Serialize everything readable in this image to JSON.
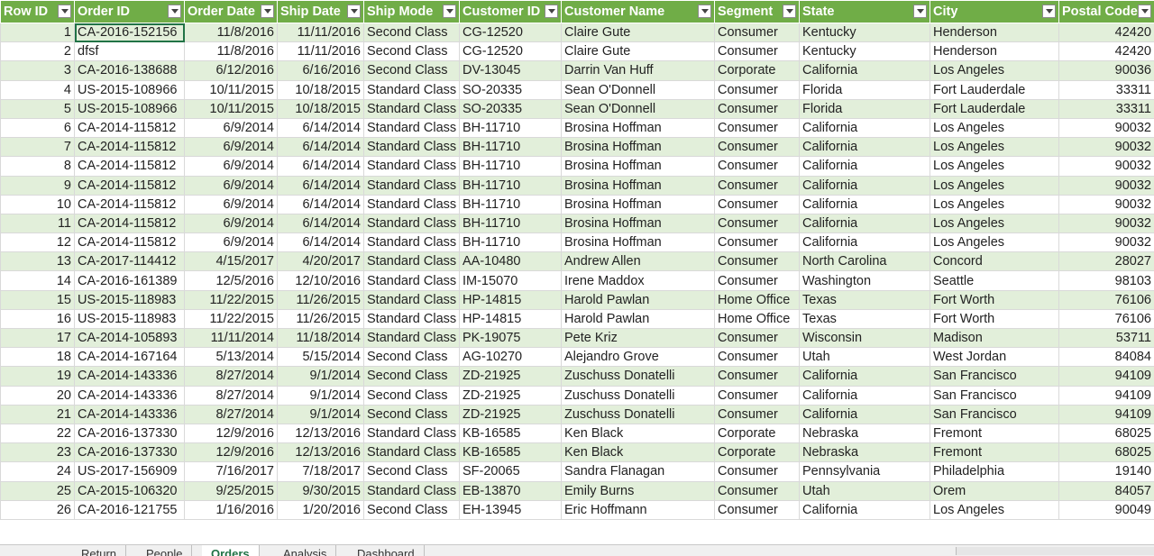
{
  "columns": [
    "Row ID",
    "Order ID",
    "Order Date",
    "Ship Date",
    "Ship Mode",
    "Customer ID",
    "Customer Name",
    "Segment",
    "State",
    "City",
    "Postal Code"
  ],
  "rows": [
    [
      "1",
      "CA-2016-152156",
      "11/8/2016",
      "11/11/2016",
      "Second Class",
      "CG-12520",
      "Claire Gute",
      "Consumer",
      "Kentucky",
      "Henderson",
      "42420"
    ],
    [
      "2",
      "dfsf",
      "11/8/2016",
      "11/11/2016",
      "Second Class",
      "CG-12520",
      "Claire Gute",
      "Consumer",
      "Kentucky",
      "Henderson",
      "42420"
    ],
    [
      "3",
      "CA-2016-138688",
      "6/12/2016",
      "6/16/2016",
      "Second Class",
      "DV-13045",
      "Darrin Van Huff",
      "Corporate",
      "California",
      "Los Angeles",
      "90036"
    ],
    [
      "4",
      "US-2015-108966",
      "10/11/2015",
      "10/18/2015",
      "Standard Class",
      "SO-20335",
      "Sean O'Donnell",
      "Consumer",
      "Florida",
      "Fort Lauderdale",
      "33311"
    ],
    [
      "5",
      "US-2015-108966",
      "10/11/2015",
      "10/18/2015",
      "Standard Class",
      "SO-20335",
      "Sean O'Donnell",
      "Consumer",
      "Florida",
      "Fort Lauderdale",
      "33311"
    ],
    [
      "6",
      "CA-2014-115812",
      "6/9/2014",
      "6/14/2014",
      "Standard Class",
      "BH-11710",
      "Brosina Hoffman",
      "Consumer",
      "California",
      "Los Angeles",
      "90032"
    ],
    [
      "7",
      "CA-2014-115812",
      "6/9/2014",
      "6/14/2014",
      "Standard Class",
      "BH-11710",
      "Brosina Hoffman",
      "Consumer",
      "California",
      "Los Angeles",
      "90032"
    ],
    [
      "8",
      "CA-2014-115812",
      "6/9/2014",
      "6/14/2014",
      "Standard Class",
      "BH-11710",
      "Brosina Hoffman",
      "Consumer",
      "California",
      "Los Angeles",
      "90032"
    ],
    [
      "9",
      "CA-2014-115812",
      "6/9/2014",
      "6/14/2014",
      "Standard Class",
      "BH-11710",
      "Brosina Hoffman",
      "Consumer",
      "California",
      "Los Angeles",
      "90032"
    ],
    [
      "10",
      "CA-2014-115812",
      "6/9/2014",
      "6/14/2014",
      "Standard Class",
      "BH-11710",
      "Brosina Hoffman",
      "Consumer",
      "California",
      "Los Angeles",
      "90032"
    ],
    [
      "11",
      "CA-2014-115812",
      "6/9/2014",
      "6/14/2014",
      "Standard Class",
      "BH-11710",
      "Brosina Hoffman",
      "Consumer",
      "California",
      "Los Angeles",
      "90032"
    ],
    [
      "12",
      "CA-2014-115812",
      "6/9/2014",
      "6/14/2014",
      "Standard Class",
      "BH-11710",
      "Brosina Hoffman",
      "Consumer",
      "California",
      "Los Angeles",
      "90032"
    ],
    [
      "13",
      "CA-2017-114412",
      "4/15/2017",
      "4/20/2017",
      "Standard Class",
      "AA-10480",
      "Andrew Allen",
      "Consumer",
      "North Carolina",
      "Concord",
      "28027"
    ],
    [
      "14",
      "CA-2016-161389",
      "12/5/2016",
      "12/10/2016",
      "Standard Class",
      "IM-15070",
      "Irene Maddox",
      "Consumer",
      "Washington",
      "Seattle",
      "98103"
    ],
    [
      "15",
      "US-2015-118983",
      "11/22/2015",
      "11/26/2015",
      "Standard Class",
      "HP-14815",
      "Harold Pawlan",
      "Home Office",
      "Texas",
      "Fort Worth",
      "76106"
    ],
    [
      "16",
      "US-2015-118983",
      "11/22/2015",
      "11/26/2015",
      "Standard Class",
      "HP-14815",
      "Harold Pawlan",
      "Home Office",
      "Texas",
      "Fort Worth",
      "76106"
    ],
    [
      "17",
      "CA-2014-105893",
      "11/11/2014",
      "11/18/2014",
      "Standard Class",
      "PK-19075",
      "Pete Kriz",
      "Consumer",
      "Wisconsin",
      "Madison",
      "53711"
    ],
    [
      "18",
      "CA-2014-167164",
      "5/13/2014",
      "5/15/2014",
      "Second Class",
      "AG-10270",
      "Alejandro Grove",
      "Consumer",
      "Utah",
      "West Jordan",
      "84084"
    ],
    [
      "19",
      "CA-2014-143336",
      "8/27/2014",
      "9/1/2014",
      "Second Class",
      "ZD-21925",
      "Zuschuss Donatelli",
      "Consumer",
      "California",
      "San Francisco",
      "94109"
    ],
    [
      "20",
      "CA-2014-143336",
      "8/27/2014",
      "9/1/2014",
      "Second Class",
      "ZD-21925",
      "Zuschuss Donatelli",
      "Consumer",
      "California",
      "San Francisco",
      "94109"
    ],
    [
      "21",
      "CA-2014-143336",
      "8/27/2014",
      "9/1/2014",
      "Second Class",
      "ZD-21925",
      "Zuschuss Donatelli",
      "Consumer",
      "California",
      "San Francisco",
      "94109"
    ],
    [
      "22",
      "CA-2016-137330",
      "12/9/2016",
      "12/13/2016",
      "Standard Class",
      "KB-16585",
      "Ken Black",
      "Corporate",
      "Nebraska",
      "Fremont",
      "68025"
    ],
    [
      "23",
      "CA-2016-137330",
      "12/9/2016",
      "12/13/2016",
      "Standard Class",
      "KB-16585",
      "Ken Black",
      "Corporate",
      "Nebraska",
      "Fremont",
      "68025"
    ],
    [
      "24",
      "US-2017-156909",
      "7/16/2017",
      "7/18/2017",
      "Second Class",
      "SF-20065",
      "Sandra Flanagan",
      "Consumer",
      "Pennsylvania",
      "Philadelphia",
      "19140"
    ],
    [
      "25",
      "CA-2015-106320",
      "9/25/2015",
      "9/30/2015",
      "Standard Class",
      "EB-13870",
      "Emily Burns",
      "Consumer",
      "Utah",
      "Orem",
      "84057"
    ],
    [
      "26",
      "CA-2016-121755",
      "1/16/2016",
      "1/20/2016",
      "Second Class",
      "EH-13945",
      "Eric Hoffmann",
      "Consumer",
      "California",
      "Los Angeles",
      "90049"
    ]
  ],
  "sheet_tabs": [
    "Return",
    "People",
    "Orders",
    "Analysis",
    "Dashboard"
  ],
  "active_sheet": "Orders",
  "colors": {
    "header_bg": "#70ad47",
    "band_bg": "#e2efda",
    "selection": "#217346"
  }
}
